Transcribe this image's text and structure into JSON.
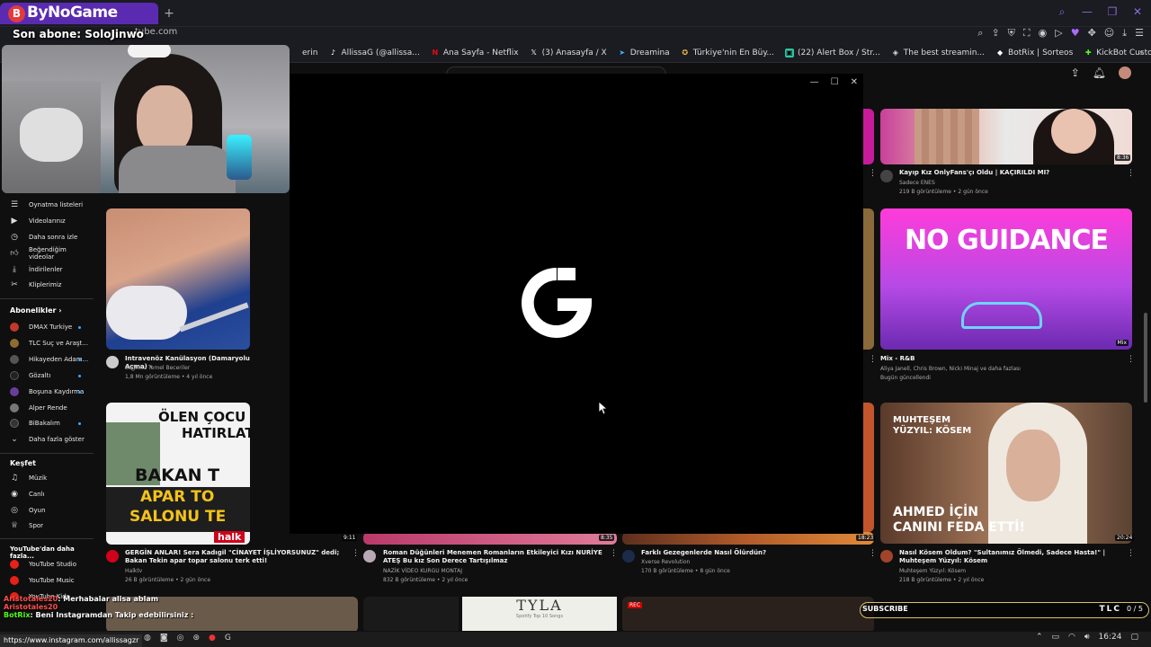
{
  "browser": {
    "tab_title": "ByNoGame",
    "tab_logo_glyph": "B",
    "new_tab_glyph": "+",
    "address_fragment": "tube.com",
    "accent_color": "#5a2bb0"
  },
  "overlay": {
    "subscriber_text": "Son abone: SoloJinwo"
  },
  "bookmarks": [
    {
      "label": "erin",
      "icon": "bookmark-icon",
      "color": "#888"
    },
    {
      "label": "AllissaG (@allissa...",
      "icon": "tiktok-icon",
      "color": "#fff"
    },
    {
      "label": "Ana Sayfa - Netflix",
      "icon": "netflix-icon",
      "color": "#e50914"
    },
    {
      "label": "(3) Anasayfa / X",
      "icon": "x-icon",
      "color": "#fff"
    },
    {
      "label": "Dreamina",
      "icon": "dreamina-icon",
      "color": "#3fb6ff"
    },
    {
      "label": "Türkiye'nin En Büy...",
      "icon": "globe-icon",
      "color": "#f5c04a"
    },
    {
      "label": "(22) Alert Box / Str...",
      "icon": "streamlabs-icon",
      "color": "#31c3a2"
    },
    {
      "label": "The best streamin...",
      "icon": "streaming-icon",
      "color": "#ddd"
    },
    {
      "label": "BotRix | Sorteos",
      "icon": "botrix-icon",
      "color": "#fff"
    },
    {
      "label": "KickBot Custom C...",
      "icon": "kickbot-icon",
      "color": "#53fc18"
    }
  ],
  "sidebar": {
    "items": [
      {
        "label": "Oynatma listeleri",
        "icon": "playlist-icon"
      },
      {
        "label": "Videolarınız",
        "icon": "your-videos-icon"
      },
      {
        "label": "Daha sonra izle",
        "icon": "watch-later-icon"
      },
      {
        "label": "Beğendiğim videolar",
        "icon": "liked-icon"
      },
      {
        "label": "İndirilenler",
        "icon": "download-icon"
      },
      {
        "label": "Kliplerimiz",
        "icon": "clips-icon"
      }
    ],
    "subscriptions_header": "Abonelikler",
    "subscriptions": [
      {
        "label": "DMAX Turkiye",
        "color": "#c0392b"
      },
      {
        "label": "TLC Suç ve Araşt...",
        "color": "#8e6b2f"
      },
      {
        "label": "Hikayeden Adam...",
        "color": "#555"
      },
      {
        "label": "Gözaltı",
        "color": "#222"
      },
      {
        "label": "Boşuna Kaydırma",
        "color": "#6a3d9a"
      },
      {
        "label": "Alper Rende",
        "color": "#777"
      },
      {
        "label": "BiBakalım",
        "color": "#333"
      }
    ],
    "show_more": "Daha fazla göster",
    "explore_header": "Keşfet",
    "explore": [
      {
        "label": "Müzik",
        "icon": "music-icon"
      },
      {
        "label": "Canlı",
        "icon": "live-icon"
      },
      {
        "label": "Oyun",
        "icon": "gaming-icon"
      },
      {
        "label": "Spor",
        "icon": "trophy-icon"
      }
    ],
    "more_header": "YouTube'dan daha fazla...",
    "more": [
      {
        "label": "YouTube Studio"
      },
      {
        "label": "YouTube Music"
      },
      {
        "label": "YouTube Kids"
      }
    ]
  },
  "videos": {
    "v1": {
      "title": "Intravenöz Kanülasyon (Damaryolu Açma) -",
      "channel": "Sağlıkta Temel Beceriler",
      "meta": "1,8 Mn görüntüleme • 4 yıl önce"
    },
    "v2": {
      "title": "Kayıp Kız OnlyFans'çı Oldu | KAÇIRILDI MI?",
      "channel": "Sadece ENES",
      "meta": "219 B görüntüleme • 2 gün önce",
      "duration": "8:36"
    },
    "v3": {
      "title": "Mix - R&B",
      "channel": "Aliya Janell, Chris Brown, Nicki Minaj ve daha fazlası",
      "meta": "Bugün güncellendi",
      "badge": "Mix",
      "thumb_text": "NO GUIDANCE"
    },
    "v4": {
      "title": "GERGİN ANLAR! Sera Kadıgil \"CİNAYET İŞLİYORSUNUZ\" dedi; Bakan Tekin apar topar salonu terk etti!",
      "channel": "Halktv",
      "meta": "26 B görüntüleme • 2 gün önce",
      "duration": "9:11",
      "thumb_line1": "ÖLEN ÇOCU",
      "thumb_line2": "HATIRLAT",
      "thumb_line3": "BAKAN T",
      "thumb_line4": "APAR TO",
      "thumb_line5": "SALONU TE",
      "thumb_brand": "halk"
    },
    "v5": {
      "title": "Roman Düğünleri Menemen Romanların Etkileyici Kızı NURİYE ATEŞ Bu kız Son Derece Tartışılmaz",
      "channel": "NAZİK VİDEO KURGU MONTAJ",
      "meta": "832 B görüntüleme • 2 yıl önce",
      "duration": "8:35"
    },
    "v6": {
      "title": "Farklı Gezegenlerde Nasıl Ölürdün?",
      "channel": "Xverse Revolution",
      "meta": "170 B görüntüleme • 8 gün önce",
      "duration": "18:23"
    },
    "v7": {
      "title": "Nasıl Kösem Oldum? \"Sultanımız Ölmedi, Sadece Hasta!\" | Muhteşem Yüzyıl: Kösem",
      "channel": "Muhteşem Yüzyıl: Kösem",
      "meta": "218 B görüntüleme • 2 yıl önce",
      "duration": "20:24",
      "thumb_top1": "MUHTEŞEM",
      "thumb_top2": "YÜZYIL: KÖSEM",
      "thumb_bottom1": "AHMED İÇİN",
      "thumb_bottom2": "CANINI FEDA ETTİ!"
    },
    "tyla_title": "TYLA",
    "tyla_sub": "Spotify Top 10 Songs",
    "rec": "REC"
  },
  "ghub": {
    "logo_color": "#ffffff",
    "bg": "#000000"
  },
  "chat": {
    "line1_user": "Aristotales20",
    "line1_text": ": Merhabalar alisa ablam",
    "line2_user": "Aristotales20",
    "line3_user": "BotRix",
    "line3_text": ": Beni Instagramdan Takip edebilirsiniz :"
  },
  "status_url": "https://www.instagram.com/allissagzr",
  "tlc": {
    "label": "TLC",
    "count": "0 / 5",
    "banner": "SUBSCRIBE"
  },
  "taskbar": {
    "time": "16:24"
  }
}
